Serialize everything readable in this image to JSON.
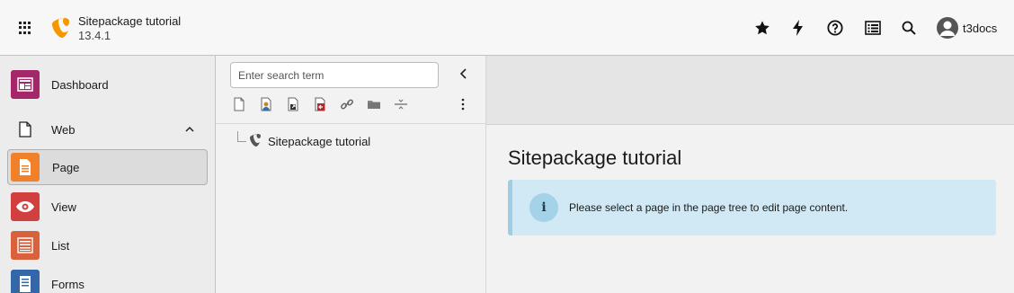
{
  "header": {
    "site_title": "Sitepackage tutorial",
    "version": "13.4.1",
    "username": "t3docs",
    "icons": [
      "app-grid-icon",
      "typo3-logo-icon",
      "star-icon",
      "lightning-icon",
      "help-icon",
      "list-icon",
      "search-icon",
      "user-avatar-icon"
    ]
  },
  "modules": {
    "dashboard": "Dashboard",
    "web": "Web",
    "page": "Page",
    "view": "View",
    "list": "List",
    "forms": "Forms"
  },
  "tree": {
    "search_placeholder": "Enter search term",
    "root_label": "Sitepackage tutorial",
    "toolbar_icons": [
      "new-page-icon",
      "backend-user-page-icon",
      "shortcut-page-icon",
      "external-link-page-icon",
      "link-icon",
      "folder-icon",
      "separator-icon",
      "more-icon"
    ]
  },
  "content": {
    "title": "Sitepackage tutorial",
    "info_icon": "i",
    "info_message": "Please select a page in the page tree to edit page content."
  },
  "colors": {
    "dashboard": "#a4276a",
    "page": "#f0812a",
    "view": "#d13f3f",
    "list": "#d9613c",
    "forms": "#3367a8",
    "info_bg": "#d0e9f4",
    "typo3_orange": "#f49700"
  }
}
